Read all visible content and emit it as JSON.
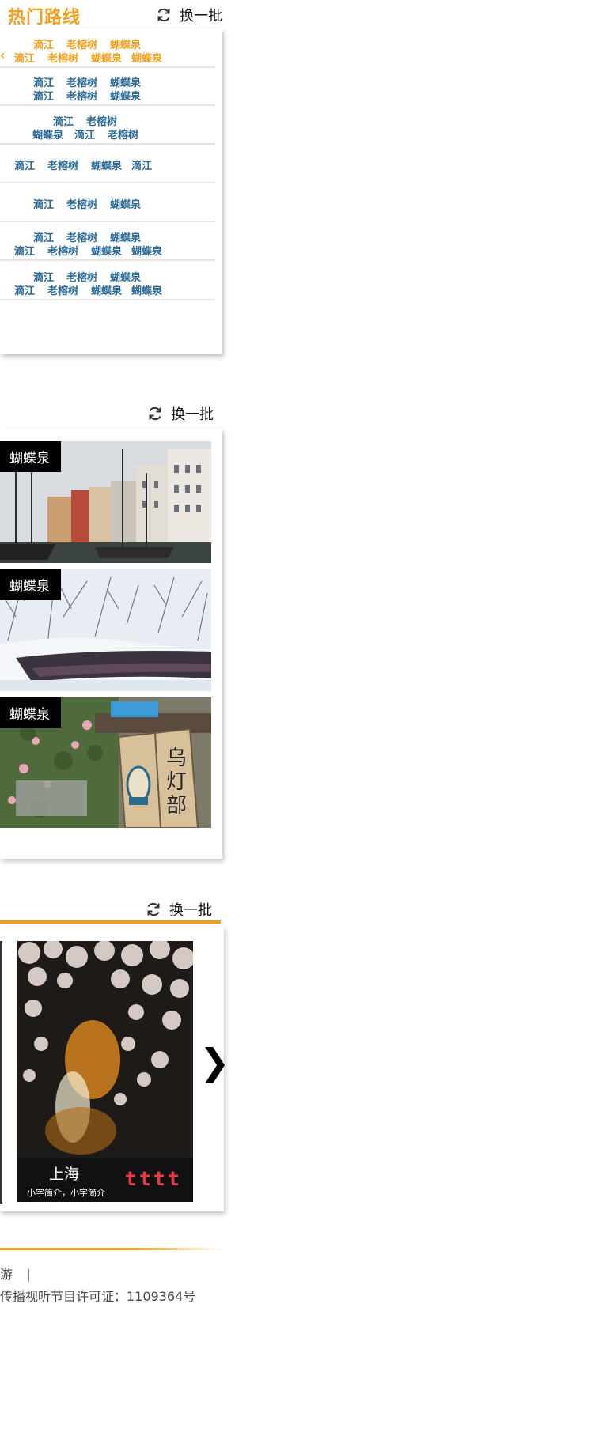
{
  "hot_routes": {
    "title": "热门路线",
    "refresh_label": "换一批",
    "rows": [
      {
        "lines": [
          [
            "滴江",
            "老榕树",
            "蝴蝶泉"
          ],
          [
            "滴江",
            "老榕树",
            "蝴蝶泉",
            "蝴蝶泉"
          ]
        ],
        "active": true
      },
      {
        "lines": [
          [
            "滴江",
            "老榕树",
            "蝴蝶泉"
          ],
          [
            "滴江",
            "老榕树",
            "蝴蝶泉"
          ]
        ]
      },
      {
        "lines": [
          [
            "滴江",
            "老榕树"
          ],
          [
            "蝴蝶泉",
            "滴江",
            "老榕树"
          ]
        ]
      },
      {
        "lines": [
          [
            "滴江",
            "老榕树",
            "蝴蝶泉",
            "滴江"
          ]
        ]
      },
      {
        "lines": [
          [
            "滴江",
            "老榕树",
            "蝴蝶泉"
          ]
        ]
      },
      {
        "lines": [
          [
            "滴江",
            "老榕树",
            "蝴蝶泉"
          ],
          [
            "滴江",
            "老榕树",
            "蝴蝶泉",
            "蝴蝶泉"
          ]
        ]
      },
      {
        "lines": [
          [
            "滴江",
            "老榕树",
            "蝴蝶泉"
          ],
          [
            "滴江",
            "老榕树",
            "蝴蝶泉",
            "蝴蝶泉"
          ]
        ]
      }
    ]
  },
  "image_section": {
    "refresh_label": "换一批",
    "cards": [
      {
        "label": "蝴蝶泉",
        "scene": "harbor-town"
      },
      {
        "label": "蝴蝶泉",
        "scene": "snowy-river"
      },
      {
        "label": "蝴蝶泉",
        "scene": "flower-lantern-sign"
      }
    ]
  },
  "carousel_section": {
    "refresh_label": "换一批",
    "slide": {
      "city": "上海",
      "desc": "小字简介，小字简介",
      "tag": "tttt",
      "scene": "night-blossoms"
    },
    "next_icon": "chevron-right-icon"
  },
  "footer": {
    "link": "游",
    "license": "传播视听节目许可证：1109364号"
  },
  "colors": {
    "accent": "#f0a020",
    "route_text": "#2c6a96",
    "tag_red": "#e8384a"
  }
}
